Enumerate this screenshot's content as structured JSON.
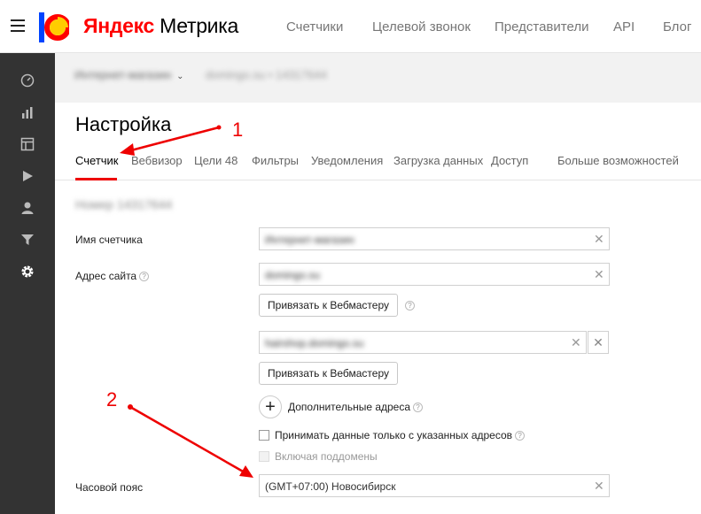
{
  "header": {
    "logo_ya": "Яндекс",
    "logo_product": "Метрика",
    "nav": [
      {
        "label": "Счетчики"
      },
      {
        "label": "Целевой звонок"
      },
      {
        "label": "Представители"
      },
      {
        "label": "API"
      },
      {
        "label": "Блог"
      }
    ],
    "brand_colors": {
      "red": "#ff0000",
      "yellow": "#ffcc00",
      "blue": "#0044ff"
    }
  },
  "sidebar": {
    "items": [
      {
        "icon": "dashboard-gauge-icon"
      },
      {
        "icon": "bar-chart-icon"
      },
      {
        "icon": "layout-icon"
      },
      {
        "icon": "play-icon"
      },
      {
        "icon": "user-icon"
      },
      {
        "icon": "filter-funnel-icon"
      },
      {
        "icon": "gear-icon"
      }
    ]
  },
  "subheader": {
    "counter_name": "Интернет-магазин",
    "counter_site": "domingo.su • 14317644"
  },
  "page": {
    "title": "Настройка",
    "tabs": [
      {
        "label": "Счетчик",
        "active": true
      },
      {
        "label": "Вебвизор"
      },
      {
        "label": "Цели 48"
      },
      {
        "label": "Фильтры"
      },
      {
        "label": "Уведомления"
      },
      {
        "label": "Загрузка данных"
      },
      {
        "label": "Доступ"
      },
      {
        "label": "Больше возможностей"
      }
    ],
    "counter_number": "Номер 14317644"
  },
  "form": {
    "counter_name_label": "Имя счетчика",
    "counter_name_value": "Интернет-магазин",
    "site_label": "Адрес сайта",
    "site_value": "domingo.su",
    "webmaster_button": "Привязать к Вебмастеру",
    "extra_site_value": "hairshop.domingo.su",
    "webmaster_button_2": "Привязать к Вебмастеру",
    "add_addresses": "Дополнительные адреса",
    "accept_only_label": "Принимать данные только с указанных адресов",
    "include_subdomains_label": "Включая поддомены",
    "timezone_label": "Часовой пояс",
    "timezone_value": "(GMT+07:00) Новосибирск",
    "clear_glyph": "✕"
  },
  "annotations": {
    "one": "1",
    "two": "2",
    "color": "#e00000"
  }
}
